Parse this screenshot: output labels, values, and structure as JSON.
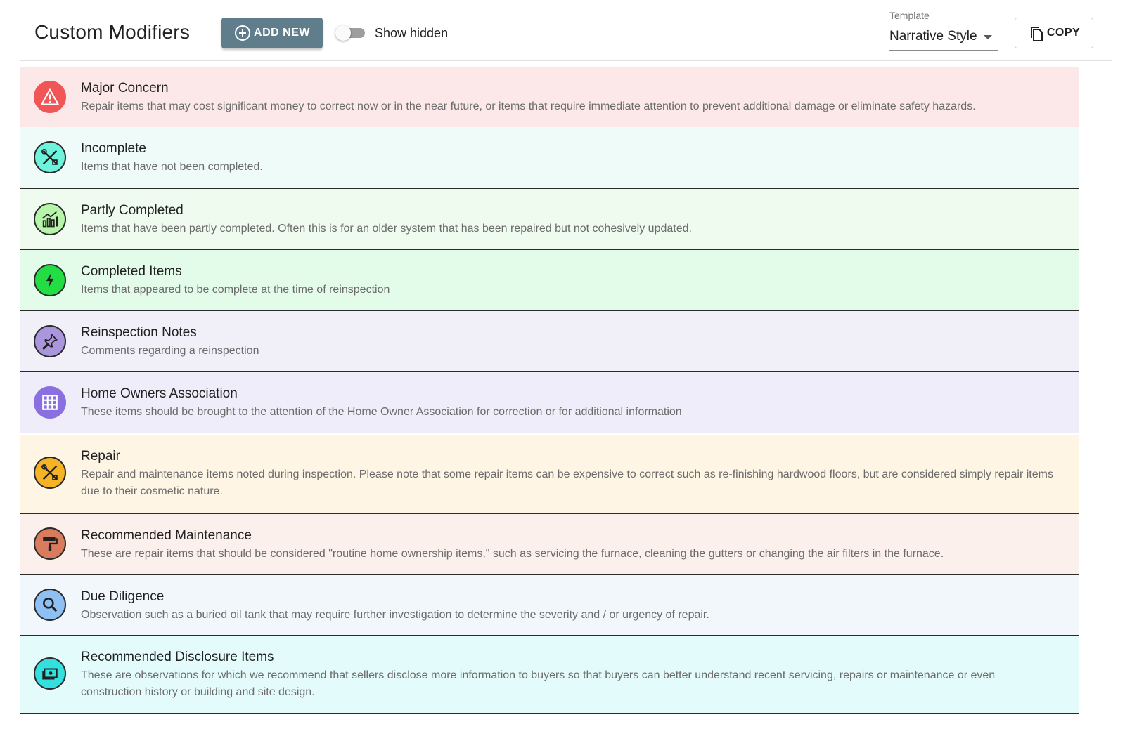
{
  "header": {
    "title": "Custom Modifiers",
    "add_label": "ADD NEW",
    "show_hidden_label": "Show hidden",
    "show_hidden_on": false,
    "template_label": "Template",
    "template_value": "Narrative Style",
    "copy_label": "COPY"
  },
  "modifiers": [
    {
      "name": "Major Concern",
      "desc": "Repair items that may cost significant money to correct now or in the near future, or items that require immediate attention to prevent additional damage or eliminate safety hazards.",
      "bg": "#fce8e8",
      "icon_bg": "#f05656",
      "icon": "warning-icon"
    },
    {
      "name": "Incomplete",
      "desc": "Items that have not been completed.",
      "bg": "#effbf9",
      "icon_bg": "#6ef3dd",
      "icon": "tools-icon"
    },
    {
      "name": "Partly Completed",
      "desc": "Items that have been partly completed. Often this is for an older system that has been repaired but not cohesively updated.",
      "bg": "#f0fbef",
      "icon_bg": "#b6f5a9",
      "icon": "chart-icon"
    },
    {
      "name": "Completed Items",
      "desc": "Items that appeared to be complete at the time of reinspection",
      "bg": "#e3fbe9",
      "icon_bg": "#22dd44",
      "icon": "lightning-icon"
    },
    {
      "name": "Reinspection Notes",
      "desc": "Comments regarding a reinspection",
      "bg": "#f1f0f9",
      "icon_bg": "#a996dc",
      "icon": "pin-icon"
    },
    {
      "name": "Home Owners Association",
      "desc": "These items should be brought to the attention of the Home Owner Association for correction or for additional information",
      "bg": "#eeedf9",
      "icon_bg": "#8a6fe0",
      "icon": "grid-icon"
    },
    {
      "name": "Repair",
      "desc": "Repair and maintenance items noted during inspection. Please note that some repair items can be expensive to correct such as re-finishing hardwood floors, but are considered simply repair items due to their cosmetic nature.",
      "bg": "#fef5e5",
      "icon_bg": "#f6b324",
      "icon": "tools-icon"
    },
    {
      "name": "Recommended Maintenance",
      "desc": "These are repair items that should be considered \"routine home ownership items,\" such as servicing the furnace, cleaning the gutters or changing the air filters in the furnace.",
      "bg": "#fbf0ec",
      "icon_bg": "#d97b5c",
      "icon": "paint-roller-icon"
    },
    {
      "name": "Due Diligence",
      "desc": "Observation such as a buried oil tank that may require further investigation to determine the severity and / or urgency of repair.",
      "bg": "#f2f7fc",
      "icon_bg": "#8ec0f3",
      "icon": "search-icon"
    },
    {
      "name": "Recommended Disclosure Items",
      "desc": "These are observations for which we recommend that sellers disclose more information to buyers so that buyers can better understand recent servicing, repairs or maintenance or even construction history or building and site design.",
      "bg": "#e3fbfa",
      "icon_bg": "#33e0de",
      "icon": "money-icon"
    }
  ]
}
